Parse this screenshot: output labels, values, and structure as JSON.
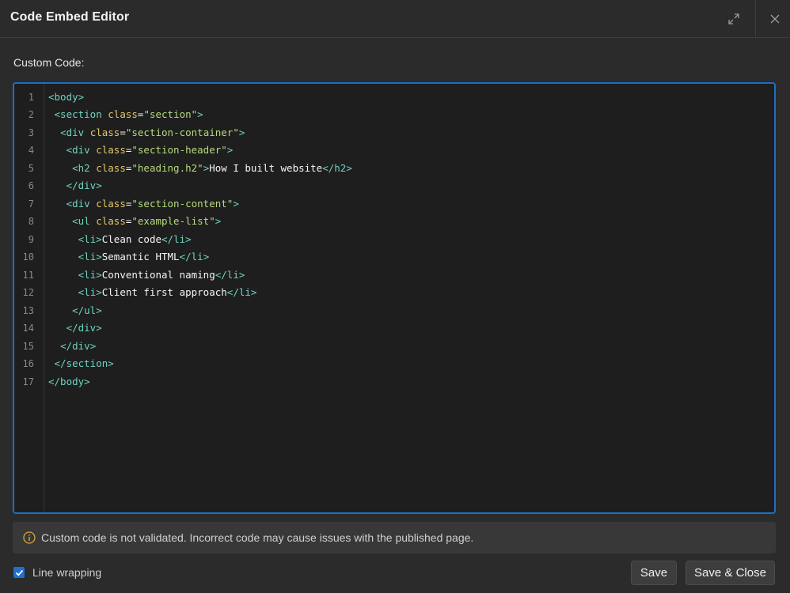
{
  "window": {
    "title": "Code Embed Editor",
    "expand_icon": "expand-icon",
    "close_icon": "close-icon"
  },
  "editor": {
    "label": "Custom Code:",
    "line_numbers": [
      "1",
      "2",
      "3",
      "4",
      "5",
      "6",
      "7",
      "8",
      "9",
      "10",
      "11",
      "12",
      "13",
      "14",
      "15",
      "16",
      "17"
    ],
    "lines": [
      "<body>",
      " <section class=\"section\">",
      "  <div class=\"section-container\">",
      "   <div class=\"section-header\">",
      "    <h2 class=\"heading.h2\">How I built website</h2>",
      "   </div>",
      "   <div class=\"section-content\">",
      "    <ul class=\"example-list\">",
      "     <li>Clean code</li>",
      "     <li>Semantic HTML</li>",
      "     <li>Conventional naming</li>",
      "     <li>Client first approach</li>",
      "    </ul>",
      "   </div>",
      "  </div>",
      " </section>",
      "</body>"
    ]
  },
  "notice": {
    "icon": "info-icon",
    "text": "Custom code is not validated. Incorrect code may cause issues with the published page."
  },
  "footer": {
    "line_wrapping_label": "Line wrapping",
    "line_wrapping_checked": true,
    "save_label": "Save",
    "save_close_label": "Save & Close"
  },
  "colors": {
    "accent": "#1d6fc4",
    "tag": "#6fd3c0",
    "attribute": "#e2c66b",
    "value": "#b5db7d"
  }
}
